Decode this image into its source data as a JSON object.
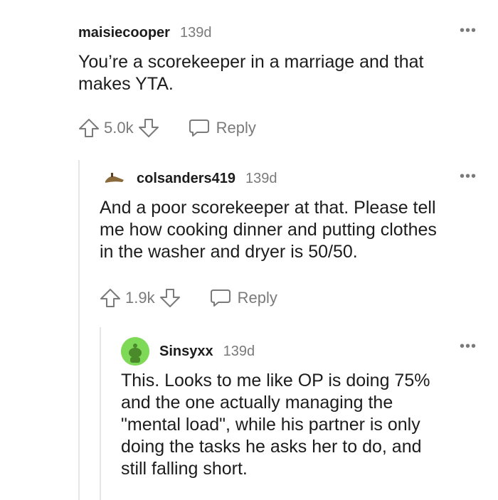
{
  "comments": [
    {
      "username": "maisiecooper",
      "time": "139d",
      "text_lines": [
        "You’re a scorekeeper in a marriage and that",
        "makes YTA."
      ],
      "score": "5.0k",
      "reply_label": "Reply"
    },
    {
      "username": "colsanders419",
      "time": "139d",
      "text_lines": [
        "And a poor scorekeeper at that. Please tell",
        "me how cooking dinner and putting clothes",
        "in the washer and dryer is 50/50."
      ],
      "score": "1.9k",
      "reply_label": "Reply"
    },
    {
      "username": "Sinsyxx",
      "time": "139d",
      "text_lines": [
        "This. Looks to me like OP is doing 75%",
        "and the one actually managing the",
        "\"mental load\", while his partner is only",
        "doing the tasks he asks her to do, and",
        "still falling short."
      ]
    }
  ],
  "icons": {
    "more": "more-options-icon",
    "upvote": "upvote-arrow-icon",
    "downvote": "downvote-arrow-icon",
    "reply": "speech-bubble-icon"
  },
  "colors": {
    "text": "#1c1c1c",
    "meta": "#7a7a7a",
    "thread_line": "#e4e6e8",
    "avatar_green": "#7ed957"
  }
}
